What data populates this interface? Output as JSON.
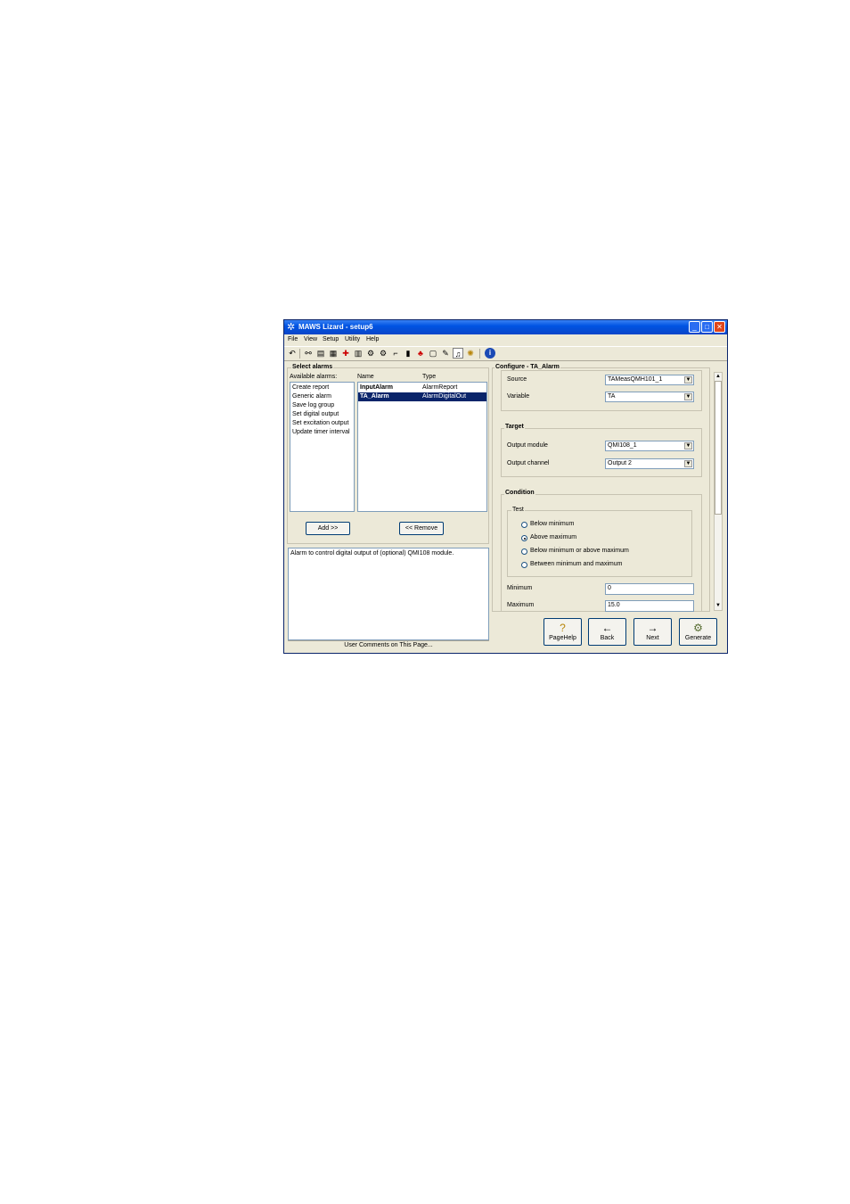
{
  "window": {
    "title": "MAWS Lizard - setup6",
    "app_icon": "lizard-icon"
  },
  "menu": [
    "File",
    "View",
    "Setup",
    "Utility",
    "Help"
  ],
  "toolbar_icons": [
    "undo-icon",
    "network-icon",
    "table-icon",
    "table-icon",
    "flag-icon",
    "sensor-icon",
    "gear-icon",
    "gear-icon",
    "chart-icon",
    "chart-icon",
    "bars-icon",
    "red-icon",
    "document-icon",
    "edit-icon",
    "bell-icon",
    "globe-icon",
    "info-icon"
  ],
  "select_alarms": {
    "title": "Select alarms",
    "available_label": "Available alarms:",
    "available": [
      "Create report",
      "Generic alarm",
      "Save log group",
      "Set digital output",
      "Set excitation output",
      "Update timer interval"
    ],
    "columns": [
      "Name",
      "Type"
    ],
    "rows": [
      {
        "name": "InputAlarm",
        "type": "AlarmReport"
      },
      {
        "name": "TA_Alarm",
        "type": "AlarmDigitalOut"
      }
    ],
    "add_label": "Add >>",
    "remove_label": "<< Remove"
  },
  "comment": {
    "text": "Alarm to control digital output of (optional) QMI108 module.",
    "footer": "User Comments on This Page..."
  },
  "configure": {
    "title": "Configure - TA_Alarm",
    "source_label": "Source",
    "source_value": "TAMeasQMH101_1",
    "variable_label": "Variable",
    "variable_value": "TA",
    "target_title": "Target",
    "output_module_label": "Output module",
    "output_module_value": "QMI108_1",
    "output_channel_label": "Output channel",
    "output_channel_value": "Output 2",
    "condition_title": "Condition",
    "test_title": "Test",
    "tests": [
      "Below minimum",
      "Above maximum",
      "Below minimum or above maximum",
      "Between minimum and maximum"
    ],
    "selected_test": "Above maximum",
    "minimum_label": "Minimum",
    "minimum_value": "0",
    "maximum_label": "Maximum",
    "maximum_value": "15.0"
  },
  "buttons": {
    "pagehelp": "PageHelp",
    "back": "Back",
    "next": "Next",
    "generate": "Generate"
  },
  "colors": {
    "titlebar": "#0054e3",
    "selection": "#0a246a",
    "window_bg": "#ece9d8"
  }
}
